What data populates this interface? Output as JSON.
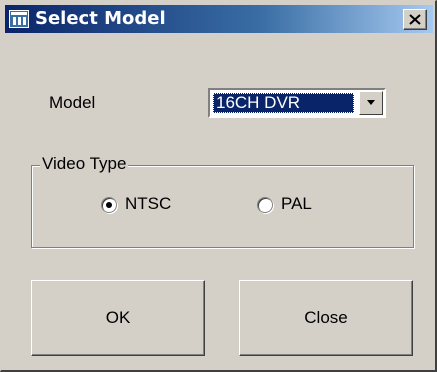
{
  "window": {
    "title": "Select Model"
  },
  "icons": {
    "app": "app-icon",
    "close": "close-icon",
    "dropdown": "chevron-down-icon"
  },
  "model": {
    "label": "Model",
    "selected": "16CH DVR"
  },
  "video_type": {
    "legend": "Video Type",
    "options": [
      {
        "label": "NTSC",
        "checked": true
      },
      {
        "label": "PAL",
        "checked": false
      }
    ]
  },
  "buttons": {
    "ok": "OK",
    "close": "Close"
  },
  "colors": {
    "titlebar_start": "#0a246a",
    "titlebar_end": "#a6caf0",
    "face": "#d4d0c8",
    "selection": "#0a246a"
  }
}
